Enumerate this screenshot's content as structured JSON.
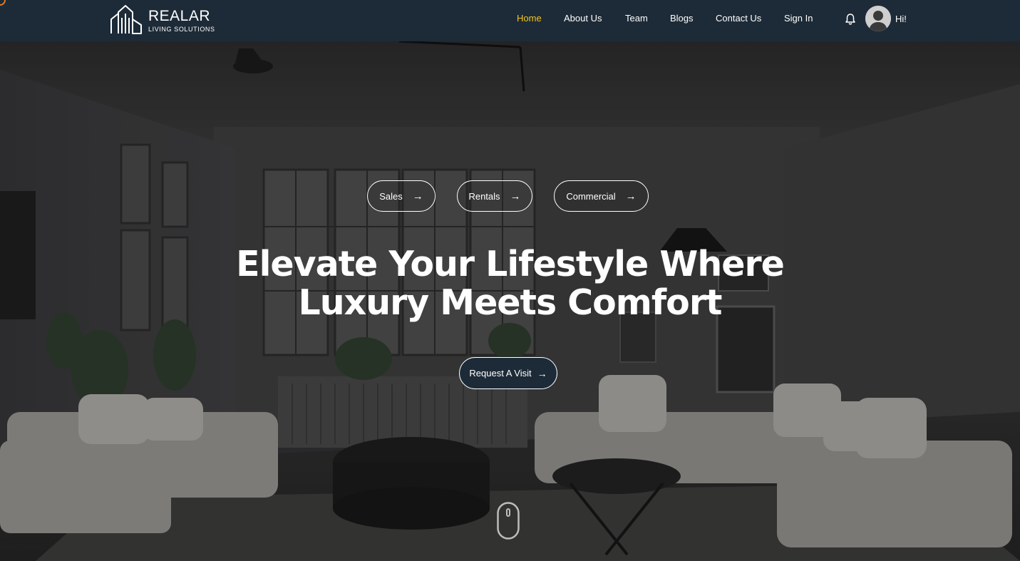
{
  "brand": {
    "name": "REALAR",
    "tagline": "LIVING SOLUTIONS"
  },
  "nav": {
    "items": [
      {
        "label": "Home",
        "active": true
      },
      {
        "label": "About Us",
        "active": false
      },
      {
        "label": "Team",
        "active": false
      },
      {
        "label": "Blogs",
        "active": false
      },
      {
        "label": "Contact Us",
        "active": false
      },
      {
        "label": "Sign In",
        "active": false
      }
    ],
    "greeting": "Hi!",
    "icons": {
      "notification": "bell-icon",
      "profile": "avatar"
    }
  },
  "hero": {
    "categories": [
      {
        "label": "Sales",
        "icon": "arrow-right-icon"
      },
      {
        "label": "Rentals",
        "icon": "arrow-right-icon"
      },
      {
        "label": "Commercial",
        "icon": "arrow-right-icon"
      }
    ],
    "headline_line1": "Elevate Your Lifestyle Where",
    "headline_line2": "Luxury Meets Comfort",
    "cta_label": "Request A Visit",
    "scroll_icon": "mouse-scroll-icon"
  },
  "colors": {
    "header_bg": "#1d2b38",
    "active_nav": "#f5c518",
    "cta_bg": "#1d2b38",
    "text": "#ffffff"
  }
}
